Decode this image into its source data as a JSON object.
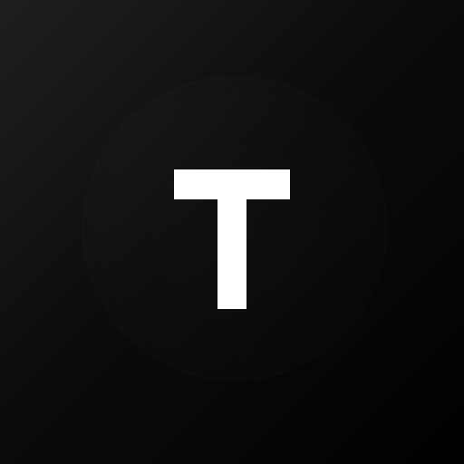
{
  "icon": {
    "letter": "T",
    "background_colors": [
      "#1f1f1f",
      "#000000"
    ],
    "letter_color": "#ffffff"
  }
}
